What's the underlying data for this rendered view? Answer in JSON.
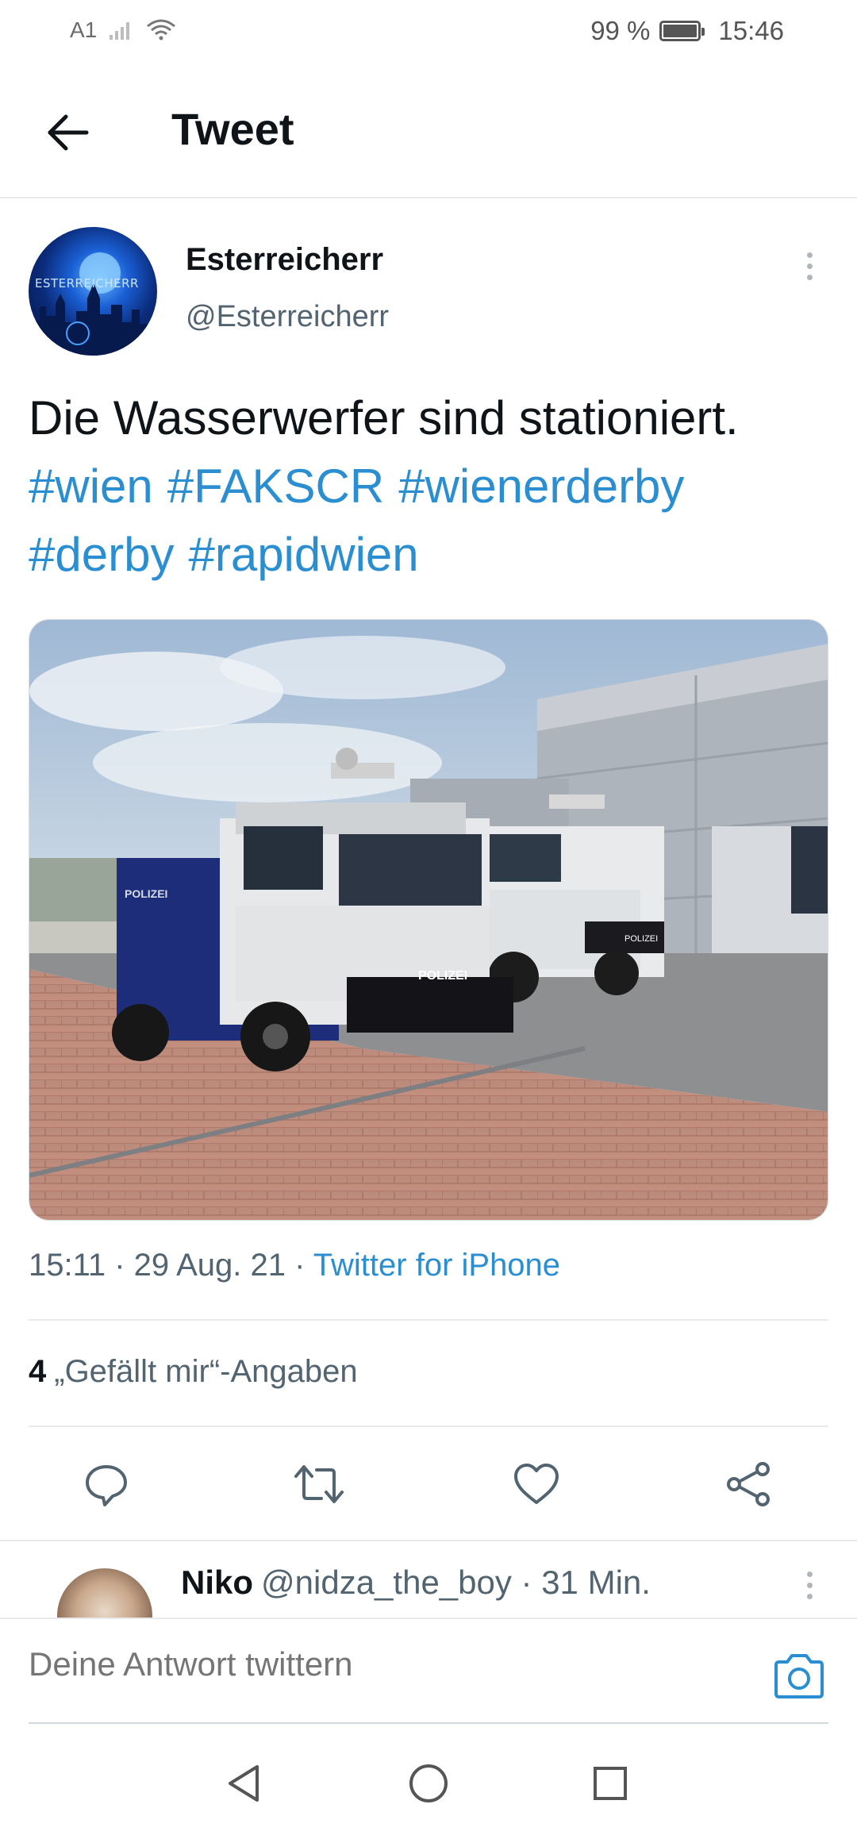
{
  "status_bar": {
    "carrier": "A1",
    "battery_percent": "99 %",
    "time": "15:46",
    "icons": [
      "signal-icon",
      "wifi-icon",
      "battery-icon"
    ]
  },
  "header": {
    "title": "Tweet",
    "back_icon": "arrow-left-icon"
  },
  "tweet": {
    "avatar_text": "ESTERREICHERR",
    "author_name": "Esterreicherr",
    "author_handle": "@Esterreicherr",
    "text": "Die Wasserwerfer sind stationiert.",
    "hashtags": [
      "#wien",
      "#FAKSCR",
      "#wienerderby",
      "#derby",
      "#rapidwien"
    ],
    "image_texts": {
      "truck_front": "POLIZEI",
      "truck_side": "POLIZEI",
      "truck2_front": "POLIZEI"
    },
    "timestamp": "15:11 · 29 Aug. 21 · ",
    "source": "Twitter for iPhone",
    "likes_count": "4",
    "likes_label": "„Gefällt mir“-Angaben"
  },
  "actions": {
    "icons": [
      "reply-icon",
      "retweet-icon",
      "like-icon",
      "share-icon"
    ]
  },
  "reply": {
    "name": "Niko",
    "meta": "@nidza_the_boy · 31 Min."
  },
  "compose": {
    "placeholder": "Deine Antwort twittern",
    "camera_icon": "camera-icon"
  },
  "colors": {
    "link_blue": "#2a8ed0",
    "text_dark": "#0f1419",
    "text_gray": "#536471",
    "divider": "#e7e9ea"
  }
}
